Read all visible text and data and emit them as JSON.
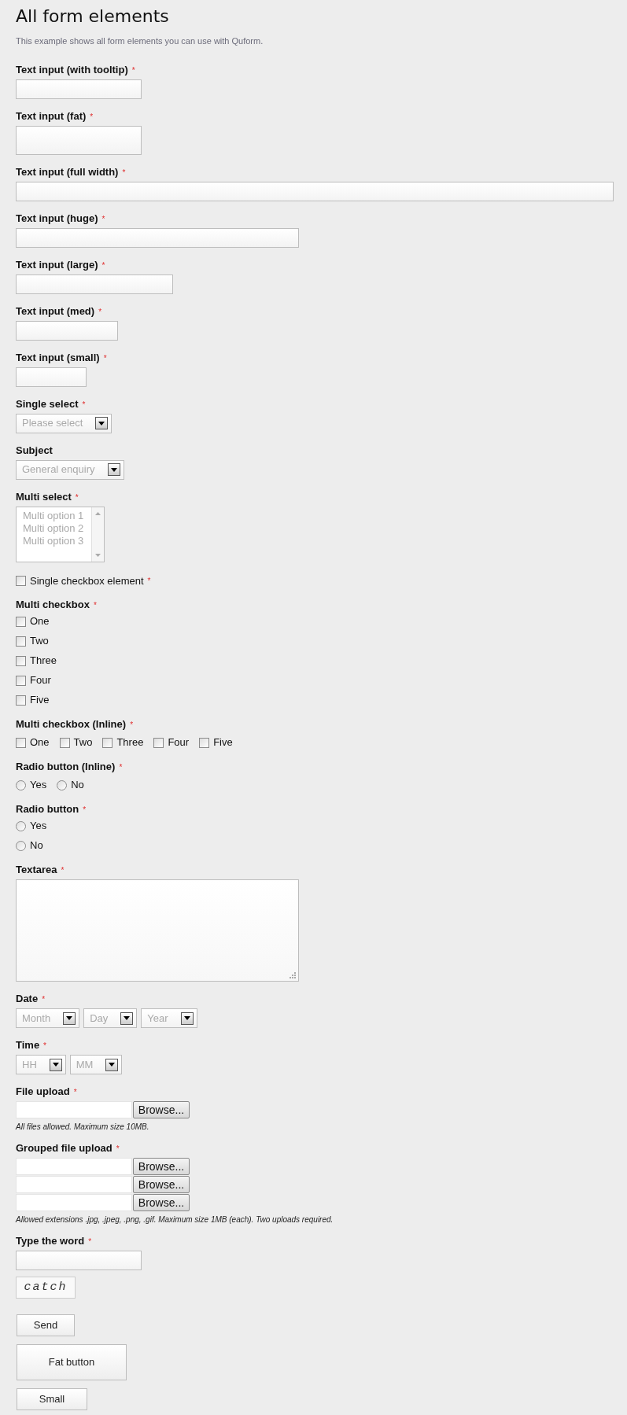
{
  "title": "All form elements",
  "description": "This example shows all form elements you can use with Quform.",
  "required_mark": "*",
  "fields": [
    {
      "kind": "text-tooltip",
      "label": "Text input (with tooltip)",
      "required": true
    },
    {
      "kind": "text-fat",
      "label": "Text input (fat)",
      "required": true
    },
    {
      "kind": "text-full",
      "label": "Text input (full width)",
      "required": true
    },
    {
      "kind": "text-huge",
      "label": "Text input (huge)",
      "required": true
    },
    {
      "kind": "text-large",
      "label": "Text input (large)",
      "required": true
    },
    {
      "kind": "text-med",
      "label": "Text input (med)",
      "required": true
    },
    {
      "kind": "text-small",
      "label": "Text input (small)",
      "required": true
    },
    {
      "kind": "select",
      "label": "Single select",
      "required": true,
      "selects": [
        "Please select"
      ]
    },
    {
      "kind": "select",
      "label": "Subject",
      "required": false,
      "selects": [
        "General enquiry"
      ]
    },
    {
      "kind": "multiselect",
      "label": "Multi select",
      "required": true,
      "options": [
        "Multi option 1",
        "Multi option 2",
        "Multi option 3"
      ]
    },
    {
      "kind": "single_checkbox",
      "label": "Single checkbox element",
      "required": true,
      "checked": false
    },
    {
      "kind": "checkboxes-stacked",
      "label": "Multi checkbox",
      "required": true,
      "items": [
        {
          "label": "One",
          "checked": false
        },
        {
          "label": "Two",
          "checked": false
        },
        {
          "label": "Three",
          "checked": false
        },
        {
          "label": "Four",
          "checked": false
        },
        {
          "label": "Five",
          "checked": false
        }
      ]
    },
    {
      "kind": "checkboxes-inline",
      "label": "Multi checkbox (Inline)",
      "required": true,
      "items": [
        {
          "label": "One",
          "checked": false
        },
        {
          "label": "Two",
          "checked": false
        },
        {
          "label": "Three",
          "checked": false
        },
        {
          "label": "Four",
          "checked": false
        },
        {
          "label": "Five",
          "checked": false
        }
      ]
    },
    {
      "kind": "radios-inline",
      "label": "Radio button (Inline)",
      "required": true,
      "items": [
        {
          "label": "Yes",
          "selected": false
        },
        {
          "label": "No",
          "selected": false
        }
      ]
    },
    {
      "kind": "radios-stacked",
      "label": "Radio button",
      "required": true,
      "items": [
        {
          "label": "Yes",
          "selected": false
        },
        {
          "label": "No",
          "selected": false
        }
      ]
    },
    {
      "kind": "textarea",
      "label": "Textarea",
      "required": true
    },
    {
      "kind": "select",
      "label": "Date",
      "required": true,
      "selects": [
        "Month",
        "Day",
        "Year"
      ]
    },
    {
      "kind": "select",
      "label": "Time",
      "required": true,
      "selects": [
        "HH",
        "MM"
      ]
    },
    {
      "kind": "file",
      "label": "File upload",
      "required": true,
      "button": [
        "Browse..."
      ],
      "hint": "All files allowed. Maximum size 10MB."
    },
    {
      "kind": "file",
      "label": "Grouped file upload",
      "required": true,
      "button": [
        "Browse...",
        "Browse...",
        "Browse..."
      ],
      "hint": "Allowed extensions .jpg, .jpeg, .png, .gif. Maximum size 1MB (each). Two uploads required."
    },
    {
      "kind": "captcha",
      "label": "Type the word",
      "required": true,
      "word": "catch"
    }
  ],
  "buttons": [
    {
      "kind": "normal",
      "label": "Send"
    },
    {
      "kind": "fat",
      "label": "Fat button"
    },
    {
      "kind": "small",
      "label": "Small"
    }
  ]
}
